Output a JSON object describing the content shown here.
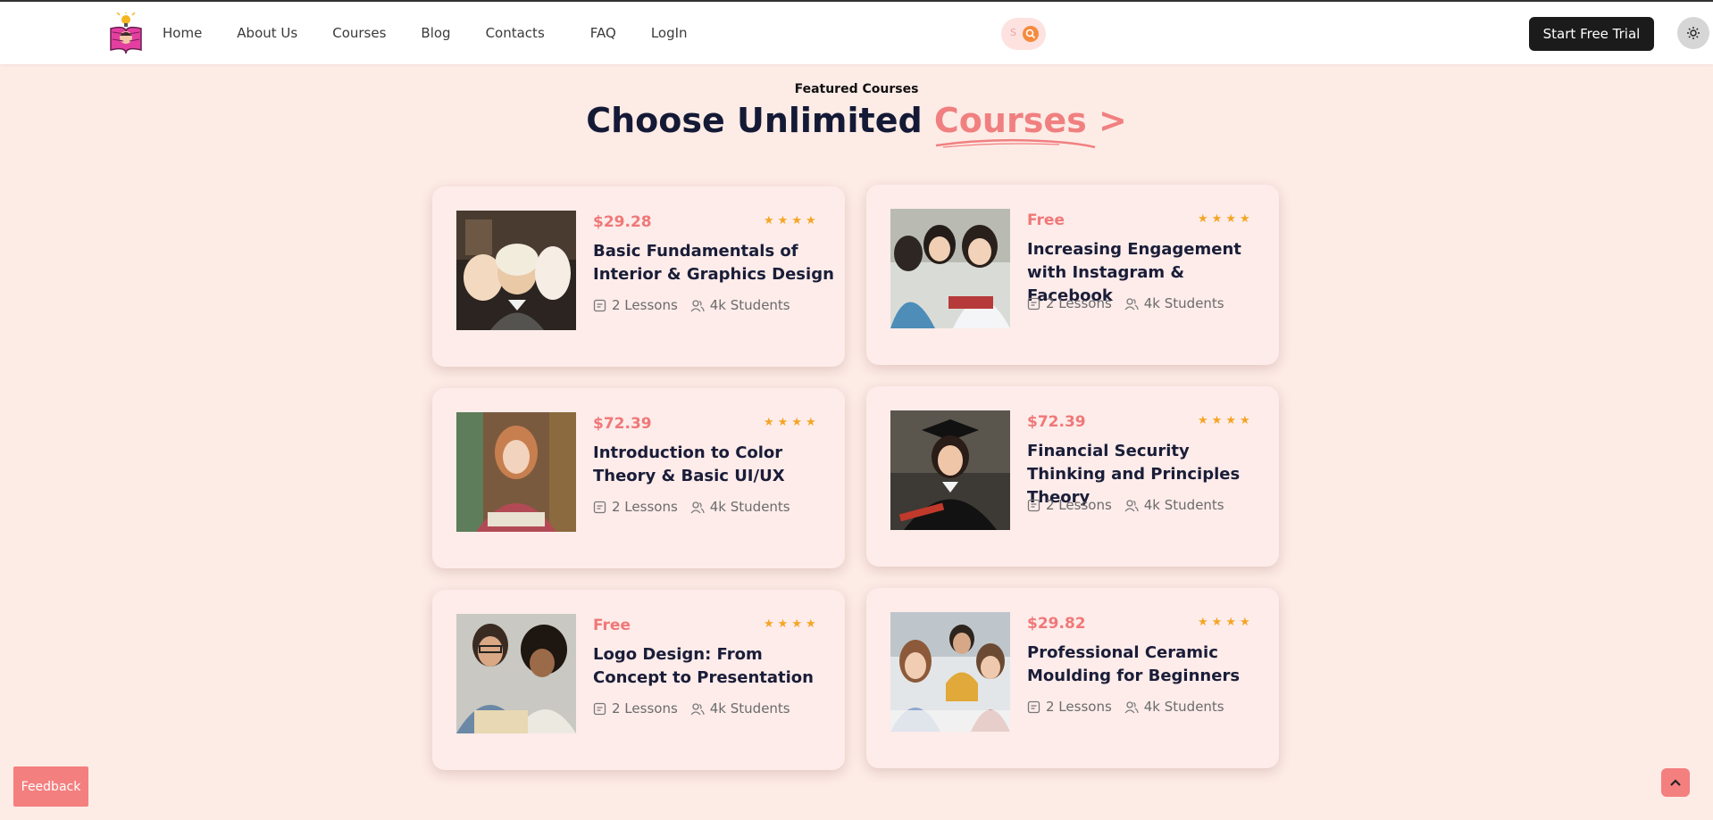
{
  "nav": {
    "items": [
      "Home",
      "About Us",
      "Courses",
      "Blog",
      "Contacts",
      "FAQ",
      "LogIn"
    ],
    "search_letter": "S",
    "cta_label": "Start Free Trial"
  },
  "section": {
    "eyebrow": "Featured Courses",
    "title_main": "Choose Unlimited",
    "title_accent": "Courses >"
  },
  "colors": {
    "accent": "#f08080",
    "star": "#f5a524",
    "dark": "#1b1b1b",
    "background": "#fdebe6"
  },
  "courses": [
    {
      "price": "$29.28",
      "title": "Basic Fundamentals of Interior & Graphics Design",
      "lessons": "2 Lessons",
      "students": "4k Students",
      "rating": 4
    },
    {
      "price": "Free",
      "title": "Increasing Engagement with Instagram & Facebook",
      "lessons": "2 Lessons",
      "students": "4k Students",
      "rating": 4
    },
    {
      "price": "$72.39",
      "title": "Introduction to Color Theory & Basic UI/UX",
      "lessons": "2 Lessons",
      "students": "4k Students",
      "rating": 4
    },
    {
      "price": "$72.39",
      "title": "Financial Security Thinking and Principles Theory",
      "lessons": "2 Lessons",
      "students": "4k Students",
      "rating": 4
    },
    {
      "price": "Free",
      "title": "Logo Design: From Concept to Presentation",
      "lessons": "2 Lessons",
      "students": "4k Students",
      "rating": 4
    },
    {
      "price": "$29.82",
      "title": "Professional Ceramic Moulding for Beginners",
      "lessons": "2 Lessons",
      "students": "4k Students",
      "rating": 4
    }
  ],
  "feedback_label": "Feedback",
  "icons": [
    "logo-book-icon",
    "search-icon",
    "sun-icon",
    "lesson-icon",
    "students-icon",
    "star-icon",
    "chevron-up-icon"
  ]
}
